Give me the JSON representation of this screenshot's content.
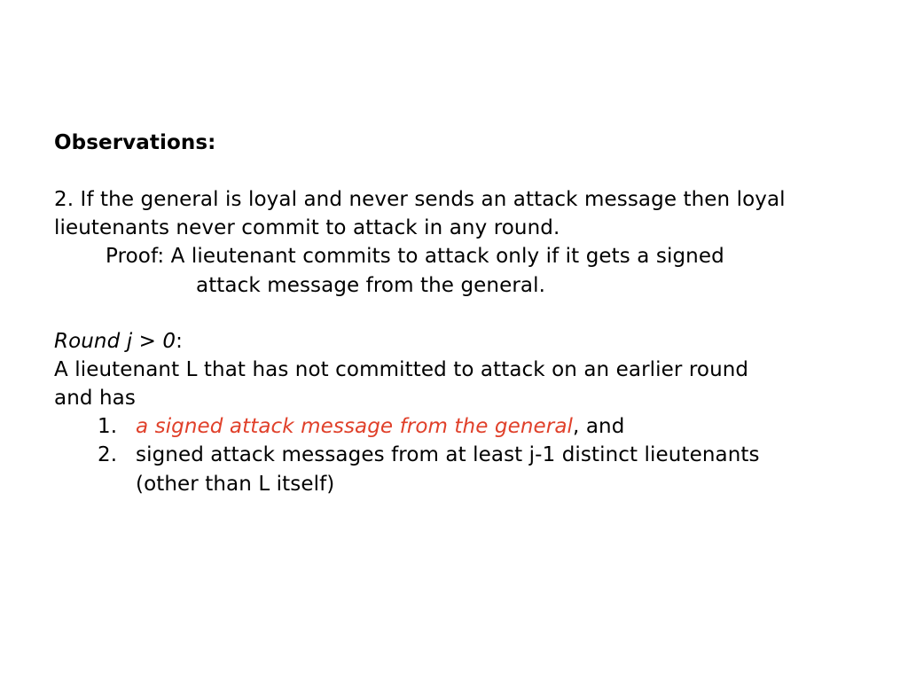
{
  "slide": {
    "heading": "Observations:",
    "obs2": {
      "line1": "2. If the general is loyal and never sends an attack message then loyal",
      "line2": "lieutenants never commit to attack in any round.",
      "proof_line1": "Proof: A lieutenant commits to attack only if it gets a signed",
      "proof_line2": "attack message from the general."
    },
    "round": {
      "label": "Round j > 0",
      "colon": ":",
      "line1": "A lieutenant L that has not committed to attack on an earlier round",
      "line2": "and has",
      "items": [
        {
          "number": "1.",
          "highlight": "a signed attack message from the general",
          "rest": ", and"
        },
        {
          "number": "2.",
          "text": "signed attack messages from at least j-1 distinct lieutenants",
          "cont": "(other than L itself)"
        }
      ]
    },
    "colors": {
      "highlight": "#e0402a",
      "text": "#000000"
    }
  }
}
